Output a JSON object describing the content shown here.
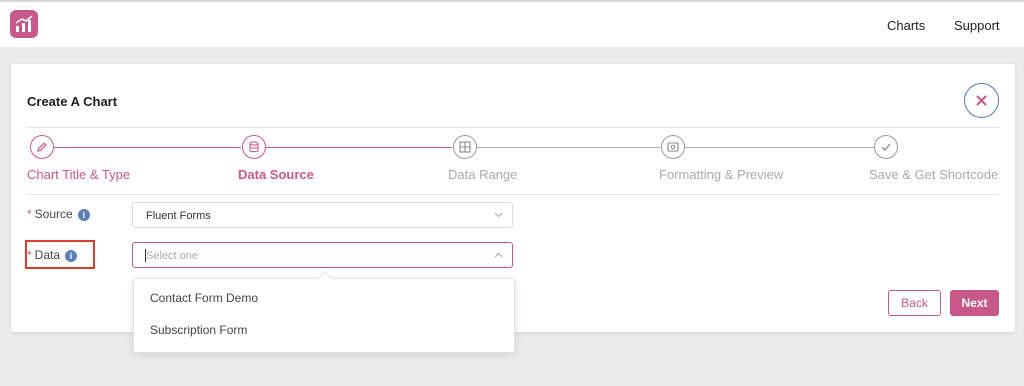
{
  "nav": {
    "charts": "Charts",
    "support": "Support"
  },
  "card": {
    "title": "Create A Chart"
  },
  "steps": [
    {
      "label": "Chart Title & Type",
      "icon": "pencil-icon",
      "state": "done"
    },
    {
      "label": "Data Source",
      "icon": "database-icon",
      "state": "current"
    },
    {
      "label": "Data Range",
      "icon": "range-icon",
      "state": "upcoming"
    },
    {
      "label": "Formatting & Preview",
      "icon": "preview-icon",
      "state": "upcoming"
    },
    {
      "label": "Save & Get Shortcode",
      "icon": "check-icon",
      "state": "upcoming"
    }
  ],
  "form": {
    "source": {
      "required": "*",
      "label": "Source",
      "value": "Fluent Forms"
    },
    "data": {
      "required": "*",
      "label": "Data",
      "placeholder": "Select one"
    }
  },
  "dropdown": {
    "options": [
      "Contact Form Demo",
      "Subscription Form"
    ]
  },
  "buttons": {
    "back": "Back",
    "next": "Next"
  },
  "colors": {
    "accent": "#c8588a",
    "close_border": "#4f7bb5",
    "highlight": "#d9402b",
    "info": "#5b7fb9"
  }
}
